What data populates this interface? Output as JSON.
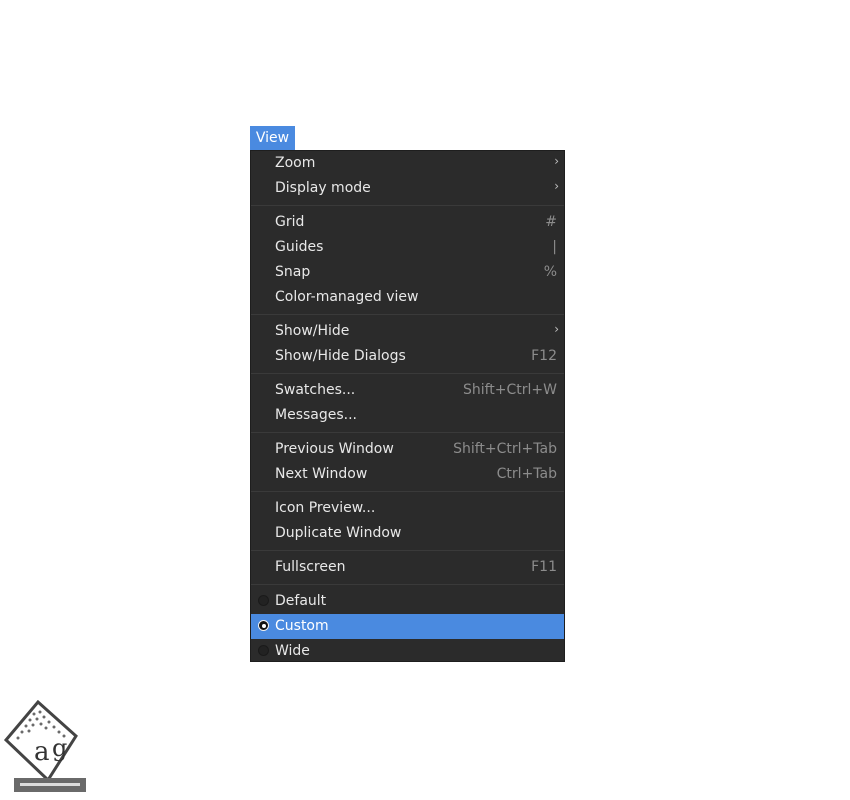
{
  "menubar": {
    "view_label": "View",
    "accent_color": "#4a8ae0"
  },
  "menu": {
    "sections": [
      [
        {
          "label": "Zoom",
          "accel": "",
          "submenu": true
        },
        {
          "label": "Display mode",
          "accel": "",
          "submenu": true
        }
      ],
      [
        {
          "label": "Grid",
          "accel": "#",
          "submenu": false
        },
        {
          "label": "Guides",
          "accel": "|",
          "submenu": false
        },
        {
          "label": "Snap",
          "accel": "%",
          "submenu": false
        },
        {
          "label": "Color-managed view",
          "accel": "",
          "submenu": false
        }
      ],
      [
        {
          "label": "Show/Hide",
          "accel": "",
          "submenu": true
        },
        {
          "label": "Show/Hide Dialogs",
          "accel": "F12",
          "submenu": false
        }
      ],
      [
        {
          "label": "Swatches...",
          "accel": "Shift+Ctrl+W",
          "submenu": false
        },
        {
          "label": "Messages...",
          "accel": "",
          "submenu": false
        }
      ],
      [
        {
          "label": "Previous Window",
          "accel": "Shift+Ctrl+Tab",
          "submenu": false
        },
        {
          "label": "Next Window",
          "accel": "Ctrl+Tab",
          "submenu": false
        }
      ],
      [
        {
          "label": "Icon Preview...",
          "accel": "",
          "submenu": false
        },
        {
          "label": "Duplicate Window",
          "accel": "",
          "submenu": false
        }
      ],
      [
        {
          "label": "Fullscreen",
          "accel": "F11",
          "submenu": false
        }
      ]
    ],
    "layouts": [
      {
        "label": "Default",
        "selected": false
      },
      {
        "label": "Custom",
        "selected": true
      },
      {
        "label": "Wide",
        "selected": false
      }
    ]
  },
  "watermark": {
    "icon": "watermark-logo-icon"
  }
}
